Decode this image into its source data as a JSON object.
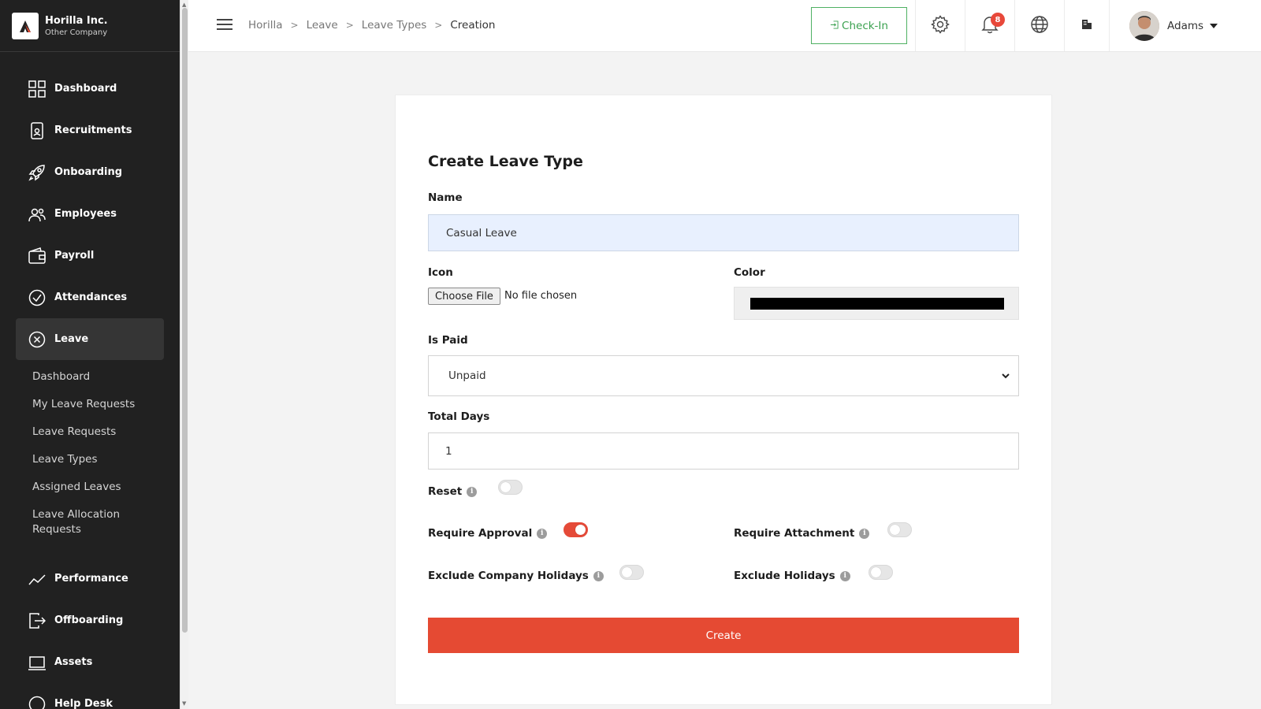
{
  "brand": {
    "name": "Horilla Inc.",
    "subtitle": "Other Company"
  },
  "sidebar": {
    "items": [
      {
        "label": "Dashboard",
        "icon": "dashboard-grid-icon"
      },
      {
        "label": "Recruitments",
        "icon": "recruitment-phone-icon"
      },
      {
        "label": "Onboarding",
        "icon": "rocket-icon"
      },
      {
        "label": "Employees",
        "icon": "people-icon"
      },
      {
        "label": "Payroll",
        "icon": "wallet-icon"
      },
      {
        "label": "Attendances",
        "icon": "check-circle-icon"
      },
      {
        "label": "Leave",
        "icon": "x-circle-icon",
        "active": true
      },
      {
        "label": "Performance",
        "icon": "trend-line-icon"
      },
      {
        "label": "Offboarding",
        "icon": "exit-icon"
      },
      {
        "label": "Assets",
        "icon": "laptop-icon"
      },
      {
        "label": "Help Desk",
        "icon": "help-icon"
      }
    ],
    "leave_subitems": [
      "Dashboard",
      "My Leave Requests",
      "Leave Requests",
      "Leave Types",
      "Assigned Leaves",
      "Leave Allocation Requests"
    ]
  },
  "header": {
    "breadcrumb": [
      "Horilla",
      "Leave",
      "Leave Types",
      "Creation"
    ],
    "checkin_label": "Check-In",
    "notification_count": "8",
    "user_name": "Adams"
  },
  "form": {
    "title": "Create Leave Type",
    "name_label": "Name",
    "name_value": "Casual Leave",
    "icon_label": "Icon",
    "file_button": "Choose File",
    "file_status": "No file chosen",
    "color_label": "Color",
    "color_value": "#000000",
    "is_paid_label": "Is Paid",
    "is_paid_value": "Unpaid",
    "total_days_label": "Total Days",
    "total_days_value": "1",
    "reset_label": "Reset",
    "reset_on": false,
    "require_approval_label": "Require Approval",
    "require_approval_on": true,
    "require_attachment_label": "Require Attachment",
    "require_attachment_on": false,
    "exclude_company_holidays_label": "Exclude Company Holidays",
    "exclude_company_holidays_on": false,
    "exclude_holidays_label": "Exclude Holidays",
    "exclude_holidays_on": false,
    "create_label": "Create"
  },
  "colors": {
    "accent": "#e54a33",
    "checkin": "#3aa14f",
    "sidebar_bg": "#212121"
  }
}
